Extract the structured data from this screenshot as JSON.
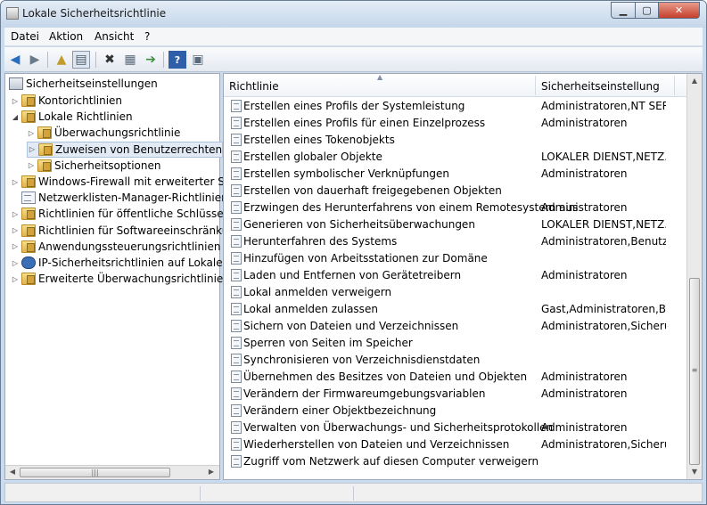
{
  "window": {
    "title": "Lokale Sicherheitsrichtlinie",
    "close_glyph": "✕",
    "min_glyph": "▁",
    "max_glyph": "▢"
  },
  "menu": [
    "Datei",
    "Aktion",
    "Ansicht",
    "?"
  ],
  "toolbar": [
    "back-icon",
    "forward-icon",
    "up-folder-icon",
    "show-tree-icon",
    "delete-icon",
    "properties-icon",
    "export-icon",
    "help-icon",
    "panel-icon"
  ],
  "tree": {
    "root": "Sicherheitseinstellungen",
    "items": [
      {
        "label": "Kontorichtlinien",
        "level": 1,
        "arrow": "▷",
        "icon": "folder"
      },
      {
        "label": "Lokale Richtlinien",
        "level": 1,
        "arrow": "◢",
        "icon": "folder"
      },
      {
        "label": "Überwachungsrichtlinie",
        "level": 2,
        "arrow": "▷",
        "icon": "folder"
      },
      {
        "label": "Zuweisen von Benutzerrechten",
        "level": 2,
        "arrow": "▷",
        "icon": "folder",
        "selected": true
      },
      {
        "label": "Sicherheitsoptionen",
        "level": 2,
        "arrow": "▷",
        "icon": "folder"
      },
      {
        "label": "Windows-Firewall mit erweiterter Sich",
        "level": 1,
        "arrow": "▷",
        "icon": "folder"
      },
      {
        "label": "Netzwerklisten-Manager-Richtlinien",
        "level": 1,
        "arrow": "",
        "icon": "doc"
      },
      {
        "label": "Richtlinien für öffentliche Schlüssel",
        "level": 1,
        "arrow": "▷",
        "icon": "folder"
      },
      {
        "label": "Richtlinien für Softwareeinschränkung",
        "level": 1,
        "arrow": "▷",
        "icon": "folder"
      },
      {
        "label": "Anwendungssteuerungsrichtlinien",
        "level": 1,
        "arrow": "▷",
        "icon": "folder"
      },
      {
        "label": "IP-Sicherheitsrichtlinien auf Lokaler C",
        "level": 1,
        "arrow": "▷",
        "icon": "ip"
      },
      {
        "label": "Erweiterte Überwachungsrichtlinienko",
        "level": 1,
        "arrow": "▷",
        "icon": "folder"
      }
    ]
  },
  "list": {
    "columns": [
      "Richtlinie",
      "Sicherheitseinstellung"
    ],
    "rows": [
      {
        "policy": "Erstellen eines Profils der Systemleistung",
        "setting": "Administratoren,NT SER..."
      },
      {
        "policy": "Erstellen eines Profils für einen Einzelprozess",
        "setting": "Administratoren"
      },
      {
        "policy": "Erstellen eines Tokenobjekts",
        "setting": ""
      },
      {
        "policy": "Erstellen globaler Objekte",
        "setting": "LOKALER DIENST,NETZ..."
      },
      {
        "policy": "Erstellen symbolischer Verknüpfungen",
        "setting": "Administratoren"
      },
      {
        "policy": "Erstellen von dauerhaft freigegebenen Objekten",
        "setting": ""
      },
      {
        "policy": "Erzwingen des Herunterfahrens von einem Remotesystem aus",
        "setting": "Administratoren"
      },
      {
        "policy": "Generieren von Sicherheitsüberwachungen",
        "setting": "LOKALER DIENST,NETZ..."
      },
      {
        "policy": "Herunterfahren des Systems",
        "setting": "Administratoren,Benutz..."
      },
      {
        "policy": "Hinzufügen von Arbeitsstationen zur Domäne",
        "setting": ""
      },
      {
        "policy": "Laden und Entfernen von Gerätetreibern",
        "setting": "Administratoren"
      },
      {
        "policy": "Lokal anmelden verweigern",
        "setting": ""
      },
      {
        "policy": "Lokal anmelden zulassen",
        "setting": "Gast,Administratoren,Be..."
      },
      {
        "policy": "Sichern von Dateien und Verzeichnissen",
        "setting": "Administratoren,Sicheru..."
      },
      {
        "policy": "Sperren von Seiten im Speicher",
        "setting": ""
      },
      {
        "policy": "Synchronisieren von Verzeichnisdienstdaten",
        "setting": ""
      },
      {
        "policy": "Übernehmen des Besitzes von Dateien und Objekten",
        "setting": "Administratoren"
      },
      {
        "policy": "Verändern der Firmwareumgebungsvariablen",
        "setting": "Administratoren"
      },
      {
        "policy": "Verändern einer Objektbezeichnung",
        "setting": ""
      },
      {
        "policy": "Verwalten von Überwachungs- und Sicherheitsprotokollen",
        "setting": "Administratoren"
      },
      {
        "policy": "Wiederherstellen von Dateien und Verzeichnissen",
        "setting": "Administratoren,Sicheru..."
      },
      {
        "policy": "Zugriff vom Netzwerk auf diesen Computer verweigern",
        "setting": ""
      }
    ]
  },
  "colors": {
    "title_bar": "#c6d7ea",
    "close_button": "#c4402b",
    "selection": "#e2ebf5"
  }
}
